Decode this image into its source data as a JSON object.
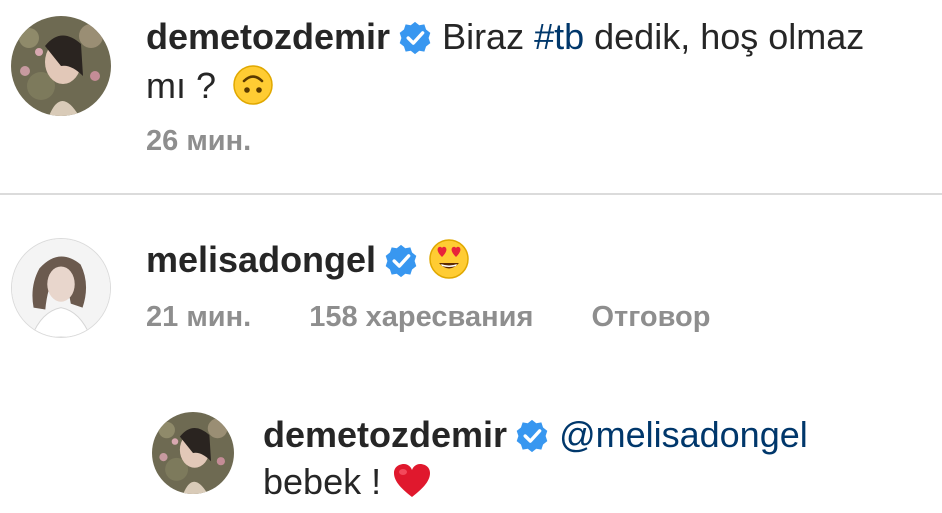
{
  "comments": [
    {
      "username": "demetozdemir",
      "verified": true,
      "text_parts": [
        "Biraz ",
        "#tb",
        " dedik, hoş olmaz",
        "mı ? "
      ],
      "emoji": "upside-down-face",
      "time": "26 мин."
    },
    {
      "username": "melisadongel",
      "verified": true,
      "emoji": "heart-eyes-face",
      "time": "21 мин.",
      "likes": "158 харесвания",
      "reply_label": "Отговор"
    }
  ],
  "reply": {
    "username": "demetozdemir",
    "verified": true,
    "mention": "@melisadongel",
    "text": "bebek ! ",
    "emoji": "red-heart"
  },
  "colors": {
    "text": "#262626",
    "meta": "#8e8e8e",
    "link": "#00376b",
    "verified": "#3897f0",
    "divider": "#dbdbdb"
  }
}
